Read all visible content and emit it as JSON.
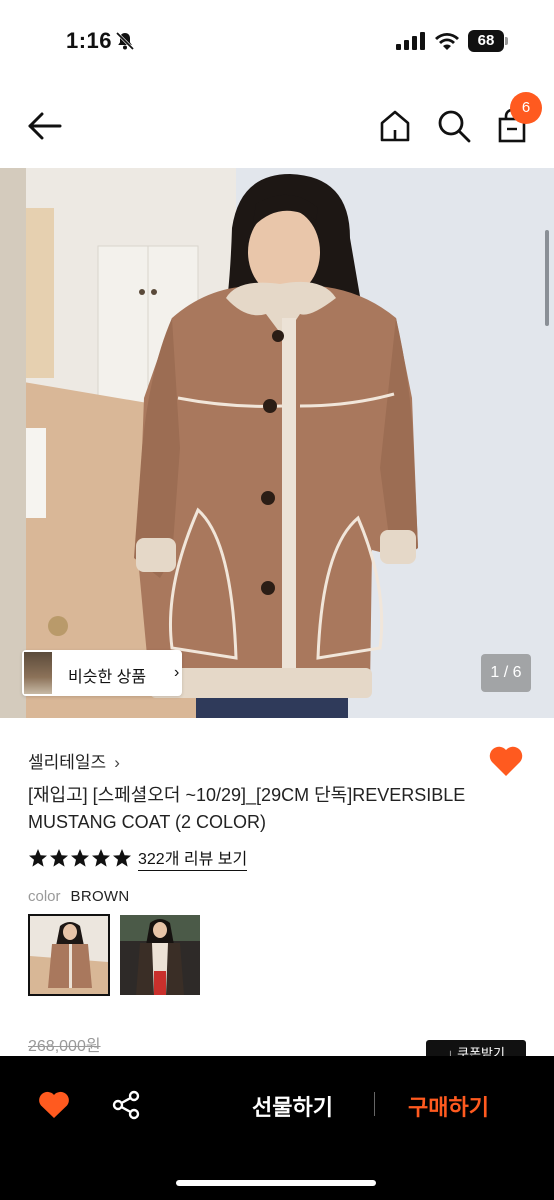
{
  "status_bar": {
    "time": "1:16",
    "battery": "68"
  },
  "header": {
    "cart_count": "6"
  },
  "hero": {
    "similar_label": "비슷한 상품",
    "chevron": "›",
    "page_counter": "1 / 6"
  },
  "product": {
    "brand": "셀리테일즈",
    "brand_chevron": "›",
    "title": "[재입고] [스페셜오더 ~10/29]_[29CM 단독]REVERSIBLE MUSTANG COAT (2 COLOR)",
    "rating": 5,
    "review_link": "322개 리뷰 보기",
    "color_key": "color",
    "color_value": "BROWN",
    "original_price": "268,000원",
    "coupon_label": "↓ 쿠폰받기"
  },
  "bottom_bar": {
    "gift_label": "선물하기",
    "buy_label": "구매하기"
  },
  "colors": {
    "accent": "#ff5a1f",
    "bar_bg": "#000000",
    "text": "#111111"
  },
  "icons": [
    "bell-off-icon",
    "signal-icon",
    "wifi-icon",
    "battery-icon",
    "back-arrow-icon",
    "home-icon",
    "search-icon",
    "cart-icon",
    "heart-icon",
    "star-icon",
    "share-icon"
  ]
}
